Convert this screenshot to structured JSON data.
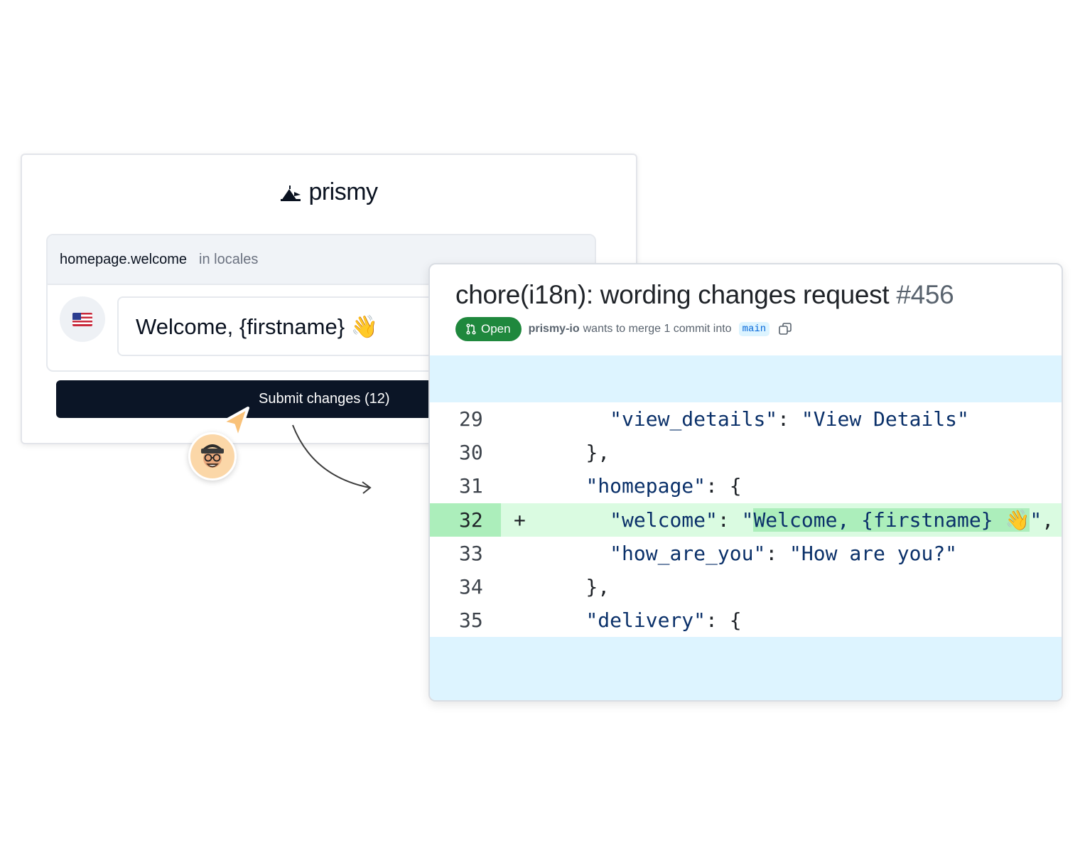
{
  "editor": {
    "logo_text": "prismy",
    "key_name": "homepage.welcome",
    "key_scope": "in locales",
    "translation_value": "Welcome, {firstname} 👋",
    "submit_label": "Submit changes (12)"
  },
  "pull_request": {
    "title": "chore(i18n): wording changes request",
    "number": "#456",
    "status": "Open",
    "author": "prismy-io",
    "merge_text": "wants to merge 1 commit into",
    "branch": "main",
    "diff_lines": [
      {
        "num": "29",
        "marker": "",
        "indent": "    ",
        "key": "\"view_details\"",
        "sep": ": ",
        "value": "\"View Details\"",
        "trail": "",
        "added": false
      },
      {
        "num": "30",
        "marker": "",
        "indent": "  ",
        "key": "",
        "sep": "",
        "value": "",
        "trail": "},",
        "added": false
      },
      {
        "num": "31",
        "marker": "",
        "indent": "  ",
        "key": "\"homepage\"",
        "sep": ": ",
        "value": "",
        "trail": "{",
        "added": false
      },
      {
        "num": "32",
        "marker": "+",
        "indent": "  ",
        "key": "\"welcome\"",
        "sep": ": ",
        "value": "\"Welcome, {firstname} 👋\"",
        "trail": ",",
        "added": true
      },
      {
        "num": "33",
        "marker": "",
        "indent": "    ",
        "key": "\"how_are_you\"",
        "sep": ": ",
        "value": "\"How are you?\"",
        "trail": "",
        "added": false
      },
      {
        "num": "34",
        "marker": "",
        "indent": "  ",
        "key": "",
        "sep": "",
        "value": "",
        "trail": "},",
        "added": false
      },
      {
        "num": "35",
        "marker": "",
        "indent": "  ",
        "key": "\"delivery\"",
        "sep": ": ",
        "value": "",
        "trail": "{",
        "added": false
      }
    ]
  },
  "colors": {
    "button_dark": "#0b1526",
    "open_green": "#1f883d",
    "hunk_blue": "#ddf4ff",
    "added_line": "#dafbe1",
    "added_highlight": "#aceebb"
  }
}
